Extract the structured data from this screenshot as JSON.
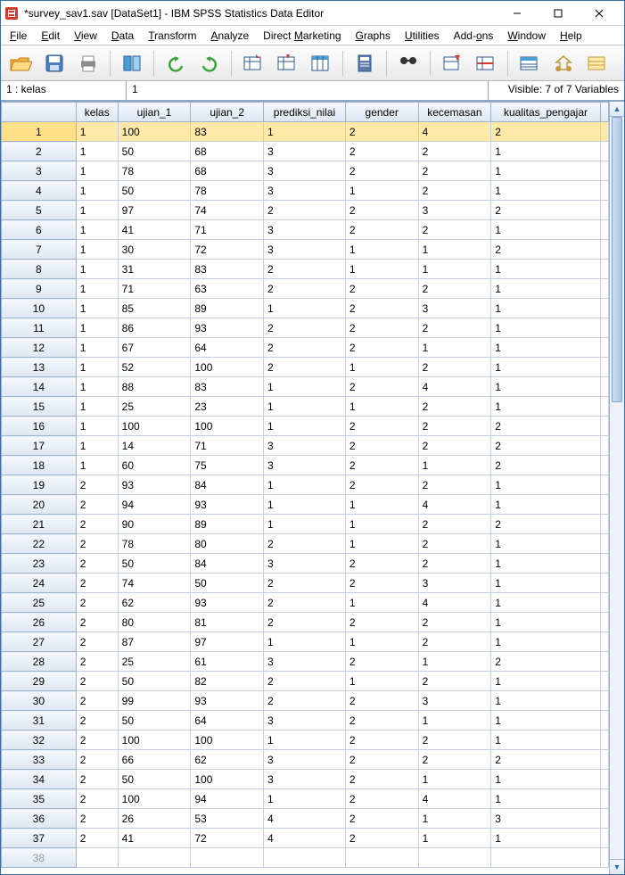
{
  "title": "*survey_sav1.sav [DataSet1] - IBM SPSS Statistics Data Editor",
  "menu": {
    "file": "File",
    "edit": "Edit",
    "view": "View",
    "data": "Data",
    "transform": "Transform",
    "analyze": "Analyze",
    "direct": "Direct Marketing",
    "graphs": "Graphs",
    "utilities": "Utilities",
    "addons": "Add-ons",
    "window": "Window",
    "help": "Help"
  },
  "cellind": {
    "left": "1 : kelas",
    "value": "1",
    "vis": "Visible: 7 of 7 Variables"
  },
  "columns": [
    "kelas",
    "ujian_1",
    "ujian_2",
    "prediksi_nilai",
    "gender",
    "kecemasan",
    "kualitas_pengajar"
  ],
  "rows": [
    {
      "n": 1,
      "sel": true,
      "v": [
        "1",
        "100",
        "83",
        "1",
        "2",
        "4",
        "2"
      ]
    },
    {
      "n": 2,
      "v": [
        "1",
        "50",
        "68",
        "3",
        "2",
        "2",
        "1"
      ]
    },
    {
      "n": 3,
      "v": [
        "1",
        "78",
        "68",
        "3",
        "2",
        "2",
        "1"
      ]
    },
    {
      "n": 4,
      "v": [
        "1",
        "50",
        "78",
        "3",
        "1",
        "2",
        "1"
      ]
    },
    {
      "n": 5,
      "v": [
        "1",
        "97",
        "74",
        "2",
        "2",
        "3",
        "2"
      ]
    },
    {
      "n": 6,
      "v": [
        "1",
        "41",
        "71",
        "3",
        "2",
        "2",
        "1"
      ]
    },
    {
      "n": 7,
      "v": [
        "1",
        "30",
        "72",
        "3",
        "1",
        "1",
        "2"
      ]
    },
    {
      "n": 8,
      "v": [
        "1",
        "31",
        "83",
        "2",
        "1",
        "1",
        "1"
      ]
    },
    {
      "n": 9,
      "v": [
        "1",
        "71",
        "63",
        "2",
        "2",
        "2",
        "1"
      ]
    },
    {
      "n": 10,
      "v": [
        "1",
        "85",
        "89",
        "1",
        "2",
        "3",
        "1"
      ]
    },
    {
      "n": 11,
      "v": [
        "1",
        "86",
        "93",
        "2",
        "2",
        "2",
        "1"
      ]
    },
    {
      "n": 12,
      "v": [
        "1",
        "67",
        "64",
        "2",
        "2",
        "1",
        "1"
      ]
    },
    {
      "n": 13,
      "v": [
        "1",
        "52",
        "100",
        "2",
        "1",
        "2",
        "1"
      ]
    },
    {
      "n": 14,
      "v": [
        "1",
        "88",
        "83",
        "1",
        "2",
        "4",
        "1"
      ]
    },
    {
      "n": 15,
      "v": [
        "1",
        "25",
        "23",
        "1",
        "1",
        "2",
        "1"
      ]
    },
    {
      "n": 16,
      "v": [
        "1",
        "100",
        "100",
        "1",
        "2",
        "2",
        "2"
      ]
    },
    {
      "n": 17,
      "v": [
        "1",
        "14",
        "71",
        "3",
        "2",
        "2",
        "2"
      ]
    },
    {
      "n": 18,
      "v": [
        "1",
        "60",
        "75",
        "3",
        "2",
        "1",
        "2"
      ]
    },
    {
      "n": 19,
      "v": [
        "2",
        "93",
        "84",
        "1",
        "2",
        "2",
        "1"
      ]
    },
    {
      "n": 20,
      "v": [
        "2",
        "94",
        "93",
        "1",
        "1",
        "4",
        "1"
      ]
    },
    {
      "n": 21,
      "v": [
        "2",
        "90",
        "89",
        "1",
        "1",
        "2",
        "2"
      ]
    },
    {
      "n": 22,
      "v": [
        "2",
        "78",
        "80",
        "2",
        "1",
        "2",
        "1"
      ]
    },
    {
      "n": 23,
      "v": [
        "2",
        "50",
        "84",
        "3",
        "2",
        "2",
        "1"
      ]
    },
    {
      "n": 24,
      "v": [
        "2",
        "74",
        "50",
        "2",
        "2",
        "3",
        "1"
      ]
    },
    {
      "n": 25,
      "v": [
        "2",
        "62",
        "93",
        "2",
        "1",
        "4",
        "1"
      ]
    },
    {
      "n": 26,
      "v": [
        "2",
        "80",
        "81",
        "2",
        "2",
        "2",
        "1"
      ]
    },
    {
      "n": 27,
      "v": [
        "2",
        "87",
        "97",
        "1",
        "1",
        "2",
        "1"
      ]
    },
    {
      "n": 28,
      "v": [
        "2",
        "25",
        "61",
        "3",
        "2",
        "1",
        "2"
      ]
    },
    {
      "n": 29,
      "v": [
        "2",
        "50",
        "82",
        "2",
        "1",
        "2",
        "1"
      ]
    },
    {
      "n": 30,
      "v": [
        "2",
        "99",
        "93",
        "2",
        "2",
        "3",
        "1"
      ]
    },
    {
      "n": 31,
      "v": [
        "2",
        "50",
        "64",
        "3",
        "2",
        "1",
        "1"
      ]
    },
    {
      "n": 32,
      "v": [
        "2",
        "100",
        "100",
        "1",
        "2",
        "2",
        "1"
      ]
    },
    {
      "n": 33,
      "v": [
        "2",
        "66",
        "62",
        "3",
        "2",
        "2",
        "2"
      ]
    },
    {
      "n": 34,
      "v": [
        "2",
        "50",
        "100",
        "3",
        "2",
        "1",
        "1"
      ]
    },
    {
      "n": 35,
      "v": [
        "2",
        "100",
        "94",
        "1",
        "2",
        "4",
        "1"
      ]
    },
    {
      "n": 36,
      "v": [
        "2",
        "26",
        "53",
        "4",
        "2",
        "1",
        "3"
      ]
    },
    {
      "n": 37,
      "v": [
        "2",
        "41",
        "72",
        "4",
        "2",
        "1",
        "1"
      ]
    },
    {
      "n": 38,
      "faded": true,
      "v": [
        "",
        "",
        "",
        "",
        "",
        "",
        ""
      ]
    }
  ]
}
